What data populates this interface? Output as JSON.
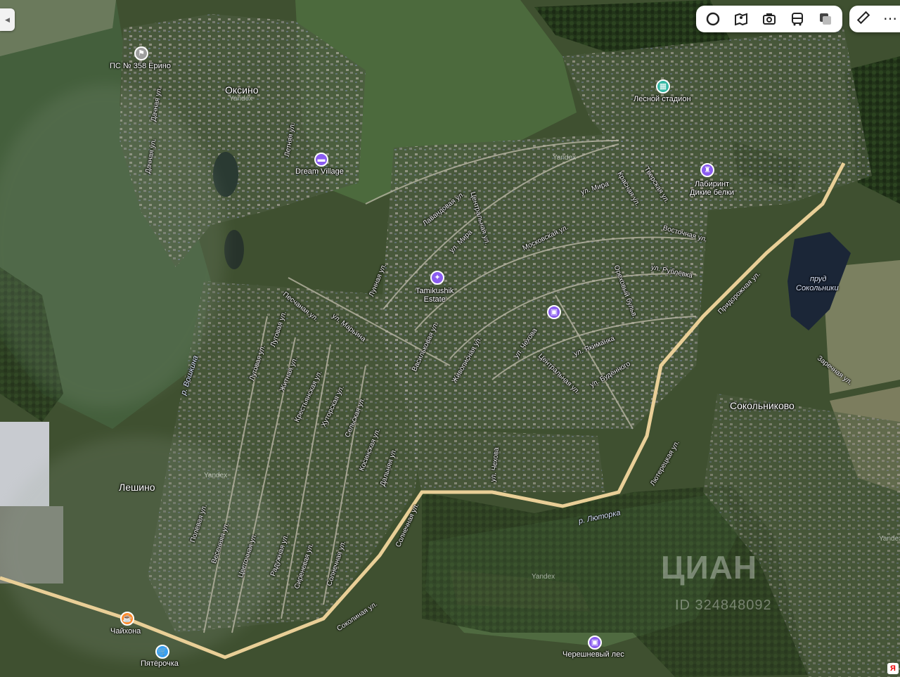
{
  "toolbar": {
    "buttons": [
      "traffic-layer",
      "panorama-view",
      "camera",
      "transit",
      "layers"
    ],
    "more_buttons": [
      "ruler",
      "more"
    ]
  },
  "settlements": {
    "oksino": "Оксино",
    "sokolnikovo": "Сокольниково",
    "leshino": "Лешино"
  },
  "pois": {
    "ps358": "ПС № 358 Ерино",
    "lesnoy": "Лесной стадион",
    "dream": "Dream Village",
    "labirint_1": "Лабиринт",
    "labirint_2": "Дикие белки",
    "tamikushik_1": "Tamikushik",
    "tamikushik_2": "Estate",
    "chaikhona": "Чайхона",
    "pyaterochka": "Пятёрочка",
    "chereshnevy": "Черешневый лес"
  },
  "water": {
    "prud_1": "пруд",
    "prud_2": "Сокольники",
    "voshkina": "р. Вошкина",
    "lyutorka": "р. Люторка"
  },
  "streets": {
    "dachnaya1": "Дачная ул.",
    "dachnaya2": "Дачная ул.",
    "letnyaya": "Летняя ул.",
    "lavandovaya": "Лавандовая ул.",
    "centralnaya1": "Центральная ул.",
    "mira1": "ул. Мира",
    "mira2": "ул. Мира",
    "moskovskaya": "Московская ул.",
    "krasnaya": "Красная ул.",
    "tverskaya": "Тверская ул.",
    "vostochnaya": "Восточная ул.",
    "rublevka": "ул. Рублёвка",
    "orekhovy": "Ореховый бульв.",
    "pridorozhnaya": "Придорожная ул.",
    "zarechnaya": "Заречная ул.",
    "lunnaya": "Лунная ул.",
    "peschanaya": "Песчаная ул.",
    "maryina": "ул. Марьина",
    "lugovaya1": "Луговая ул.",
    "lugovaya2": "Луговая ул.",
    "vasilkovaya": "Васильковая ул.",
    "zhivopisnaya": "Живописная ул.",
    "chekhova1": "ул. Чехова",
    "yakimanka": "ул. Якиманка",
    "centralnaya2": "Центральная ул.",
    "budennogo": "ул. Будённого",
    "zhitnaya": "Житная ул.",
    "krestyanskaya": "Крестьянская ул.",
    "khutorskaya": "Хуторская ул.",
    "selskaya": "Сельская ул.",
    "kosinskaya": "Косинская ул.",
    "dalnyaya": "Дальняя ул.",
    "chekhova2": "ул. Чехова",
    "lyuterskaya": "Лютерецкая ул.",
    "polevaya": "Полевая ул.",
    "vesennyaya": "Весенняя ул.",
    "tsvetochnaya": "Цветочная ул.",
    "raduzhnaya": "Радужная ул.",
    "sirenevaya": "Сиреневая ул.",
    "solnechnaya1": "Солнечная ул.",
    "solnechnaya2": "Солнечная ул.",
    "sokolinaya": "Соколиная ул."
  },
  "yandex_marks": [
    "Yandex",
    "Yandex",
    "Yandex",
    "Yandex",
    "Yandex"
  ],
  "watermark": {
    "brand": "ЦИАН",
    "id": "ID 324848092"
  },
  "colors": {
    "road": "#e9cf97",
    "poi_purple": "#8a5cf0",
    "poi_orange": "#ff8a2b",
    "poi_blue": "#3aa0f0",
    "poi_teal": "#34b7a3",
    "poi_gray": "#9e9e9e"
  }
}
